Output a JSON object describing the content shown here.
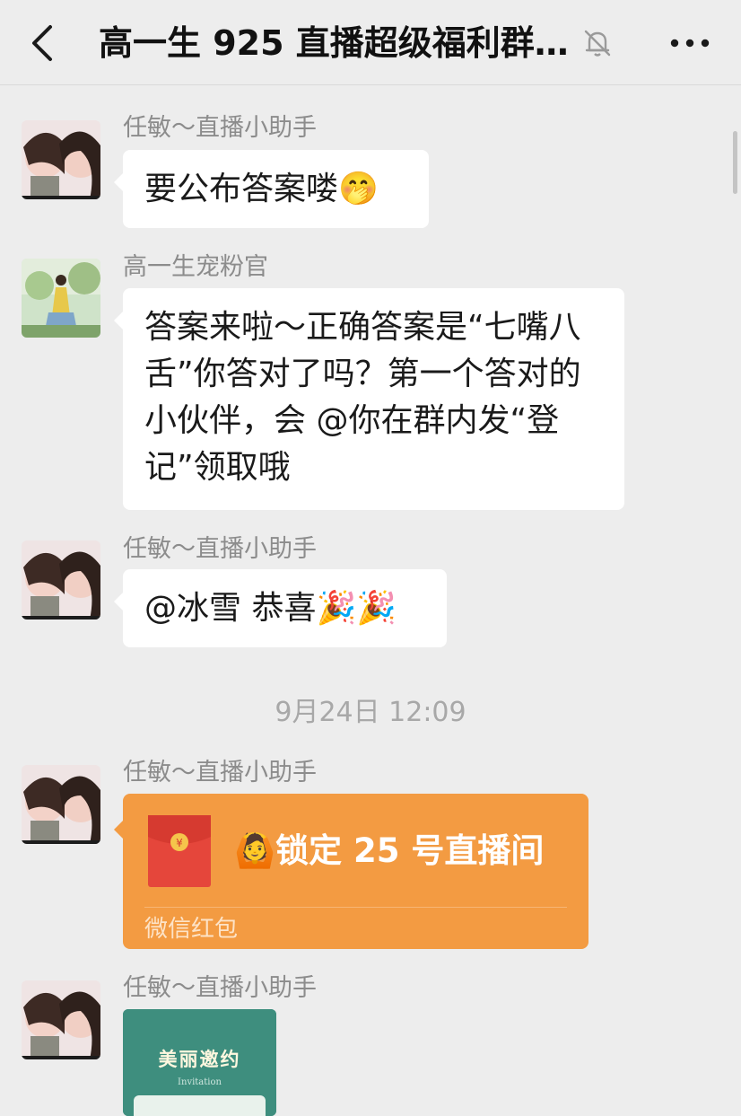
{
  "header": {
    "title": "高一生 925 直播超级福利群…",
    "back_icon": "chevron-left-icon",
    "mute_icon": "bell-off-icon",
    "more_icon": "more-dots-icon"
  },
  "messages": [
    {
      "sender": "任敏～直播小助手",
      "text": "要公布答案喽🤭"
    },
    {
      "sender": "高一生宠粉官",
      "text": "答案来啦～正确答案是“七嘴八舌”你答对了吗？第一个答对的小伙伴，会 @你在群内发“登记”领取哦"
    },
    {
      "sender": "任敏～直播小助手",
      "text": "@冰雪 恭喜🎉🎉"
    }
  ],
  "timestamp": "9月24日 12:09",
  "red_packet": {
    "sender": "任敏～直播小助手",
    "title": "🙆锁定 25 号直播间",
    "label": "微信红包",
    "icon": "red-envelope-icon",
    "color": "#f39b42"
  },
  "image_message": {
    "sender": "任敏～直播小助手",
    "card_title": "美丽邀约",
    "card_subtitle": "Invitation"
  }
}
